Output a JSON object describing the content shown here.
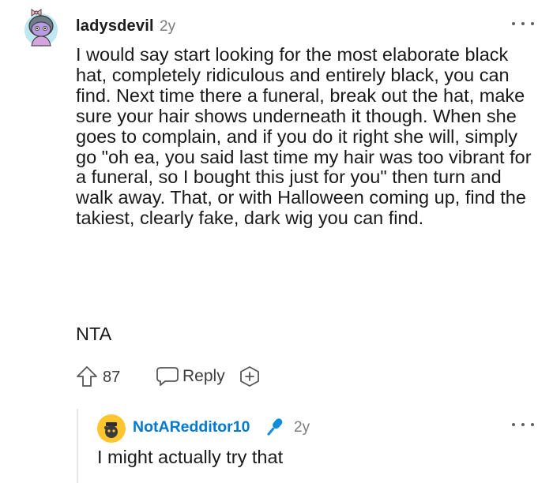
{
  "comment": {
    "username": "ladysdevil",
    "age": "2y",
    "text": "I would say start looking for the most elaborate black hat, completely ridiculous and entirely black, you can find. Next time there a funeral, break out the hat, make sure your hair shows underneath it though. When she goes to complain, and if you do it right she will, simply go \"oh ea, you said last time my hair was too vibrant for a funeral, so I bought this just for you\" then turn and walk away. That, or with Halloween coming up, find the takiest, clearly fake, dark wig you can find.",
    "text2": "NTA",
    "votes": "87",
    "reply_label": "Reply"
  },
  "reply": {
    "username": "NotARedditor10",
    "age": "2y",
    "text": "I might actually try that"
  },
  "colors": {
    "username_link": "#0079d3",
    "mic_badge": "#0d8de0",
    "meta_gray": "#7c7c7c"
  },
  "icons": [
    "avatar-snoo",
    "more-options-icon",
    "upvote-arrow-icon",
    "reply-bubble-icon",
    "award-plus-icon",
    "microphone-icon"
  ]
}
